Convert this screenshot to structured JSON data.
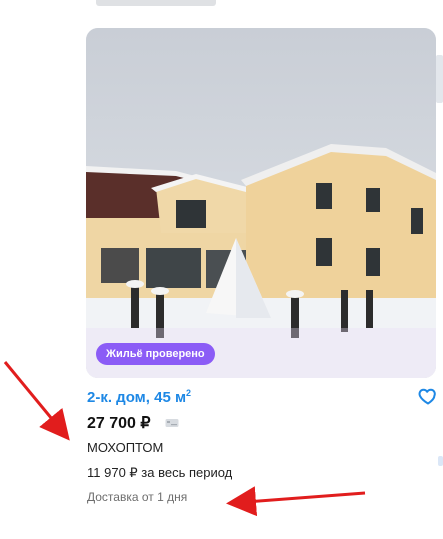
{
  "listing": {
    "badge": "Жильё проверено",
    "title_main": "2-к. дом, 45 м",
    "title_sup": "2",
    "price": "27 700 ₽",
    "subtitle": "МОХОПТОМ",
    "total": "11 970 ₽ за весь период",
    "delivery": "Доставка от 1 дня"
  },
  "colors": {
    "accent_blue": "#1e88e5",
    "badge_purple": "#8b5cf6",
    "arrow_red": "#e11d1d"
  },
  "icons": {
    "favorite": "heart-outline-icon",
    "price_hint": "card-icon"
  }
}
